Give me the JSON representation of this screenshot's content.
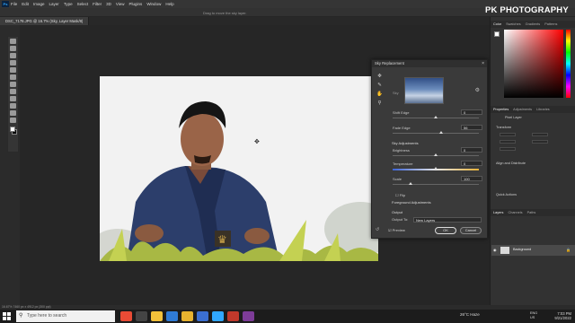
{
  "app": {
    "logo": "Ps",
    "menu": [
      "File",
      "Edit",
      "Image",
      "Layer",
      "Type",
      "Select",
      "Filter",
      "3D",
      "View",
      "Plugins",
      "Window",
      "Help"
    ],
    "drag_hint": "Drag to move the sky layer."
  },
  "document_tab": "DSC_7178.JPG @ 16.7% (Sky, Layer Mask/8)",
  "watermark": "PK PHOTOGRAPHY",
  "dialog": {
    "title": "Sky Replacement",
    "sky_label": "Sky",
    "shift_edge": {
      "label": "Shift Edge",
      "value": "0"
    },
    "fade_edge": {
      "label": "Fade Edge",
      "value": "56"
    },
    "sky_adjustments": "Sky Adjustments",
    "brightness": {
      "label": "Brightness",
      "value": "0"
    },
    "temperature": {
      "label": "Temperature",
      "value": "0"
    },
    "scale": {
      "label": "Scale",
      "value": "100"
    },
    "flip": "Flip",
    "foreground_adjustments": "Foreground Adjustments",
    "output_section": "Output",
    "output_to_label": "Output To:",
    "output_to_value": "New Layers",
    "preview": "Preview",
    "ok": "OK",
    "cancel": "Cancel"
  },
  "right_panel": {
    "color_tabs": [
      "Color",
      "Swatches",
      "Gradients",
      "Patterns"
    ],
    "prop_tabs": [
      "Properties",
      "Adjustments",
      "Libraries"
    ],
    "pixel_layer": "Pixel Layer",
    "transform": "Transform",
    "align": "Align and Distribute",
    "quick_actions": "Quick Actions",
    "layer_tabs": [
      "Layers",
      "Channels",
      "Paths"
    ],
    "layer_name": "Background"
  },
  "status_bar": "16.67%    7460 px x 4912 px (300 ppi)",
  "taskbar": {
    "search_placeholder": "Type here to search",
    "weather": "26°C  Haze",
    "lang": "ENG",
    "region": "US",
    "time": "7:03 PM",
    "date": "9/21/2022"
  },
  "colors": {
    "accent_dialog": "#3a3a3a",
    "temperature_left": "#3c64d8",
    "temperature_right": "#e6b23a"
  }
}
